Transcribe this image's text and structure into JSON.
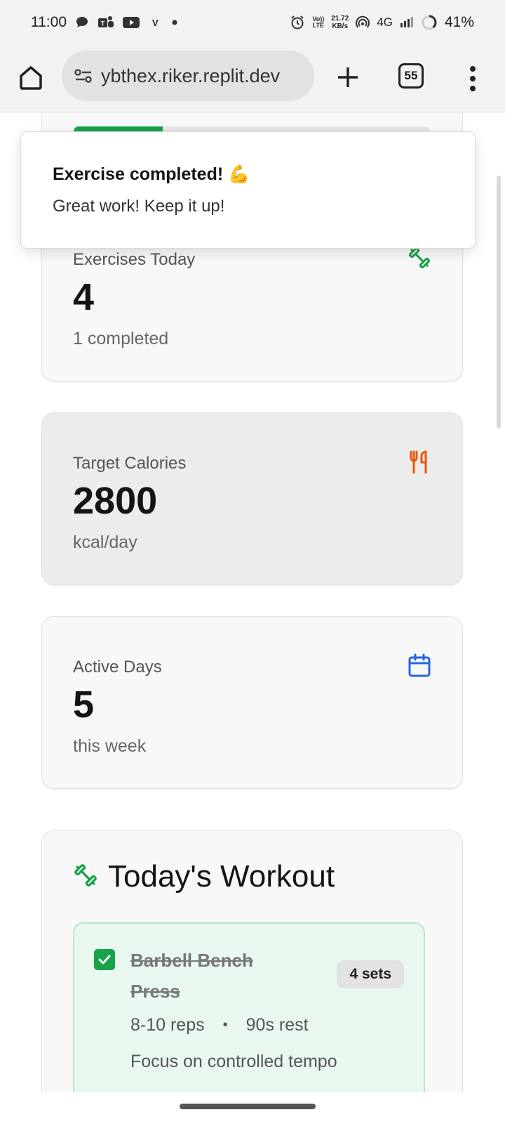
{
  "status_bar": {
    "time": "11:00",
    "carrier_letter": "V",
    "net_speed": "21.72",
    "net_unit": "KB/s",
    "volte_top": "Vo))",
    "volte_bottom": "LTE",
    "network": "4G",
    "battery": "41%"
  },
  "browser": {
    "url": "ybthex.riker.replit.dev",
    "tab_count": "55"
  },
  "progress": {
    "completed_fraction": 0.25,
    "color": "#16a34a"
  },
  "toast": {
    "title": "Exercise completed! 💪",
    "description": "Great work! Keep it up!"
  },
  "stats": [
    {
      "label": "Exercises Today",
      "value": "4",
      "sub": "1 completed",
      "icon": "dumbbell-icon",
      "color": "#16a34a"
    },
    {
      "label": "Target Calories",
      "value": "2800",
      "sub": "kcal/day",
      "icon": "utensils-icon",
      "color": "#ea580c"
    },
    {
      "label": "Active Days",
      "value": "5",
      "sub": "this week",
      "icon": "calendar-icon",
      "color": "#2563eb"
    }
  ],
  "workout": {
    "title": "Today's Workout",
    "exercise": {
      "name": "Barbell Bench Press",
      "sets": "4 sets",
      "reps": "8-10 reps",
      "bullet": "•",
      "rest": "90s rest",
      "note": "Focus on controlled tempo",
      "completed": true
    }
  }
}
